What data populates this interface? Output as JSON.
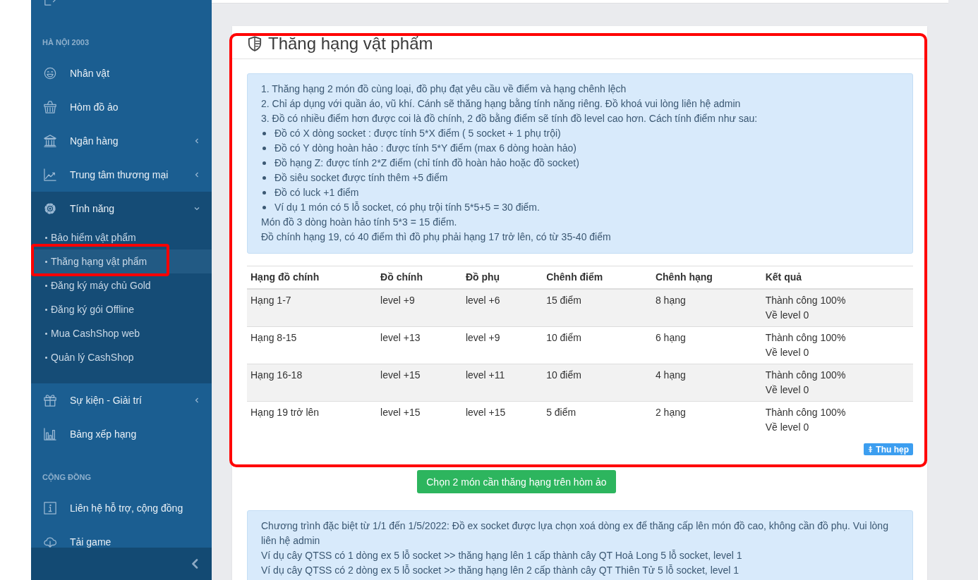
{
  "sidebar": {
    "sections": [
      {
        "items": [
          {
            "kind": "link"
          }
        ]
      },
      {
        "heading": "HÀ NỘI 2003",
        "items": [
          {
            "kind": "link",
            "label": "Nhân vật"
          },
          {
            "kind": "link",
            "label": "Hòm đồ ảo"
          },
          {
            "kind": "submenu",
            "label": "Ngân hàng",
            "expanded": false
          },
          {
            "kind": "submenu",
            "label": "Trung tâm thương mại",
            "expanded": false
          },
          {
            "kind": "submenu",
            "label": "Tính năng",
            "expanded": true,
            "children": [
              {
                "label": "Bảo hiểm vật phẩm",
                "selected": false,
                "highlighted": false
              },
              {
                "label": "Thăng hạng vật phẩm",
                "selected": true,
                "highlighted": true
              },
              {
                "label": "Đăng ký máy chủ Gold",
                "selected": false,
                "highlighted": false
              },
              {
                "label": "Đăng ký gói Offline",
                "selected": false,
                "highlighted": false
              },
              {
                "label": "Mua CashShop web",
                "selected": false,
                "highlighted": false
              },
              {
                "label": "Quản lý CashShop",
                "selected": false,
                "highlighted": false
              }
            ]
          },
          {
            "kind": "submenu",
            "label": "Sự kiện - Giải trí",
            "expanded": false
          },
          {
            "kind": "link",
            "label": "Bảng xếp hạng"
          }
        ]
      },
      {
        "heading": "CỘNG ĐỒNG",
        "items": [
          {
            "kind": "link",
            "label": "Liên hệ hỗ trợ, cộng đồng"
          },
          {
            "kind": "link",
            "label": "Tải game"
          }
        ]
      }
    ]
  },
  "panel": {
    "title": "Thăng hạng vật phẩm",
    "highlighted": true,
    "notes": [
      {
        "kind": "line",
        "text": "1. Thăng hạng 2 món đồ cùng loại, đồ phụ đạt yêu cầu về điểm và hạng chênh lệch"
      },
      {
        "kind": "line",
        "text": "2. Chỉ áp dụng với quần áo, vũ khí. Cánh sẽ thăng hạng bằng tính năng riêng. Đồ khoá vui lòng liên hệ admin"
      },
      {
        "kind": "line",
        "text": "3. Đồ có nhiều điểm hơn được coi là đồ chính, 2 đồ bằng điểm sẽ tính đồ level cao hơn. Cách tính điểm như sau:"
      },
      {
        "kind": "bullet",
        "text": "Đồ có X dòng socket : được tính 5*X điểm ( 5 socket + 1 phụ trội)"
      },
      {
        "kind": "bullet",
        "text": "Đồ có Y dòng hoàn hảo : được tính 5*Y điểm (max 6 dòng hoàn hảo)"
      },
      {
        "kind": "bullet",
        "text": "Đồ hạng Z: được tính 2*Z điểm (chỉ tính đồ hoàn hảo hoặc đồ socket)"
      },
      {
        "kind": "bullet",
        "text": "Đồ siêu socket được tính thêm +5 điểm"
      },
      {
        "kind": "bullet",
        "text": "Đồ có luck +1 điểm"
      },
      {
        "kind": "bullet",
        "text": "Ví dụ 1 món có 5 lỗ socket, có phụ trội tính 5*5+5 = 30 điểm."
      },
      {
        "kind": "line",
        "text": "Món đồ 3 dòng hoàn hảo tính 5*3 = 15 điểm."
      },
      {
        "kind": "line",
        "text": "Đồ chính hạng 19, có 40 điểm thì đồ phụ phải hạng 17 trở lên, có từ 35-40 điểm"
      }
    ],
    "table": {
      "columns": [
        "Hạng đồ chính",
        "Đồ chính",
        "Đồ phụ",
        "Chênh điểm",
        "Chênh hạng",
        "Kết quả"
      ],
      "rows": [
        [
          "Hạng 1-7",
          "level +9",
          "level +6",
          "15 điểm",
          "8 hạng",
          "Thành công 100%\nVề level 0"
        ],
        [
          "Hạng 8-15",
          "level +13",
          "level +9",
          "10 điểm",
          "6 hạng",
          "Thành công 100%\nVề level 0"
        ],
        [
          "Hạng 16-18",
          "level +15",
          "level +11",
          "10 điểm",
          "4 hạng",
          "Thành công 100%\nVề level 0"
        ],
        [
          "Hạng 19 trở lên",
          "level +15",
          "level +15",
          "5 điểm",
          "2 hạng",
          "Thành công 100%\nVề level 0"
        ]
      ]
    },
    "collapse_button": "Thu hẹp"
  },
  "action_button": "Chọn 2 món cần thăng hạng trên hòm ảo",
  "promo": {
    "lines": [
      "Chương trình đặc biệt từ 1/1 đến 1/5/2022: Đồ ex socket được lựa chọn xoá dòng ex để thăng cấp lên món đồ cao, không cần đồ phụ. Vui lòng liên hệ admin",
      "Ví dụ cây QTSS có 1 dòng ex 5 lỗ socket >> thăng hạng lên 1 cấp thành cây QT Hoả Long 5 lỗ socket, level 1",
      "Ví dụ cây QTSS có 2 dòng ex 5 lỗ socket >> thăng hạng lên 2 cấp thành cây QT Thiên Tử 5 lỗ socket, level 1"
    ]
  }
}
